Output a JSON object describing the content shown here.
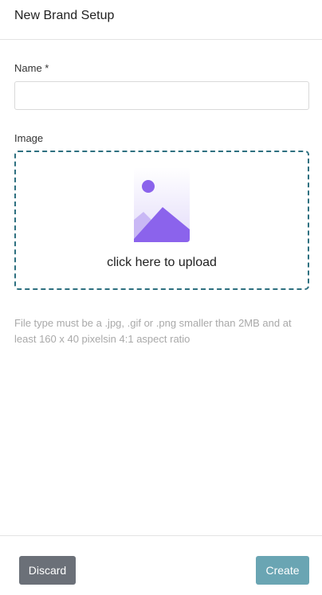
{
  "header": {
    "title": "New Brand Setup"
  },
  "form": {
    "name_label": "Name *",
    "name_value": "",
    "name_placeholder": "",
    "image_label": "Image",
    "upload_text": "click here to upload",
    "hint": "File type must be a .jpg, .gif or .png smaller than 2MB and at least 160 x 40 pixelsin 4:1 aspect ratio"
  },
  "footer": {
    "discard_label": "Discard",
    "create_label": "Create"
  },
  "icons": {
    "upload": "image-placeholder-icon"
  },
  "colors": {
    "upload_border": "#2e7080",
    "icon_purple": "#8b63ec",
    "discard_bg": "#6b7078",
    "create_bg": "#6aa5b3",
    "hint_text": "#a9a9a9"
  }
}
